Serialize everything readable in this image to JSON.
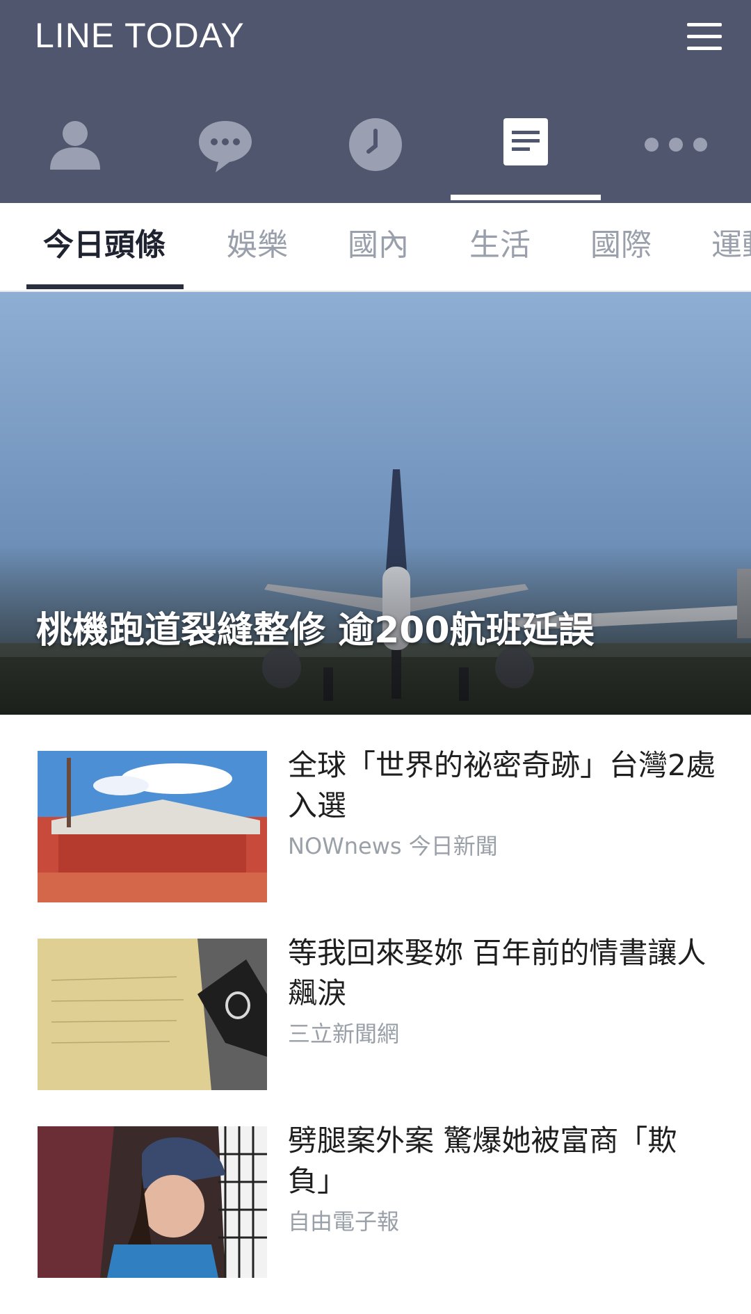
{
  "header": {
    "app_title": "LINE TODAY",
    "bg_color": "#4f566d",
    "tabs": [
      {
        "name": "friends",
        "icon": "person-icon"
      },
      {
        "name": "chats",
        "icon": "chat-bubble-icon"
      },
      {
        "name": "timeline",
        "icon": "clock-icon"
      },
      {
        "name": "news",
        "icon": "news-icon",
        "active": true
      },
      {
        "name": "more",
        "icon": "more-dots-icon"
      }
    ]
  },
  "categories": {
    "items": [
      "今日頭條",
      "娛樂",
      "國內",
      "生活",
      "國際",
      "運動"
    ],
    "active_index": 0
  },
  "hero": {
    "title": "桃機跑道裂縫整修 逾200航班延誤",
    "slides_count": 9,
    "active_slide": 5
  },
  "news": [
    {
      "title": "全球「世界的祕密奇跡」台灣2處入選",
      "source": "NOWnews 今日新聞"
    },
    {
      "title": "等我回來娶妳 百年前的情書讓人飆淚",
      "source": "三立新聞網"
    },
    {
      "title": "劈腿案外案 驚爆她被富商「欺負」",
      "source": "自由電子報"
    }
  ]
}
